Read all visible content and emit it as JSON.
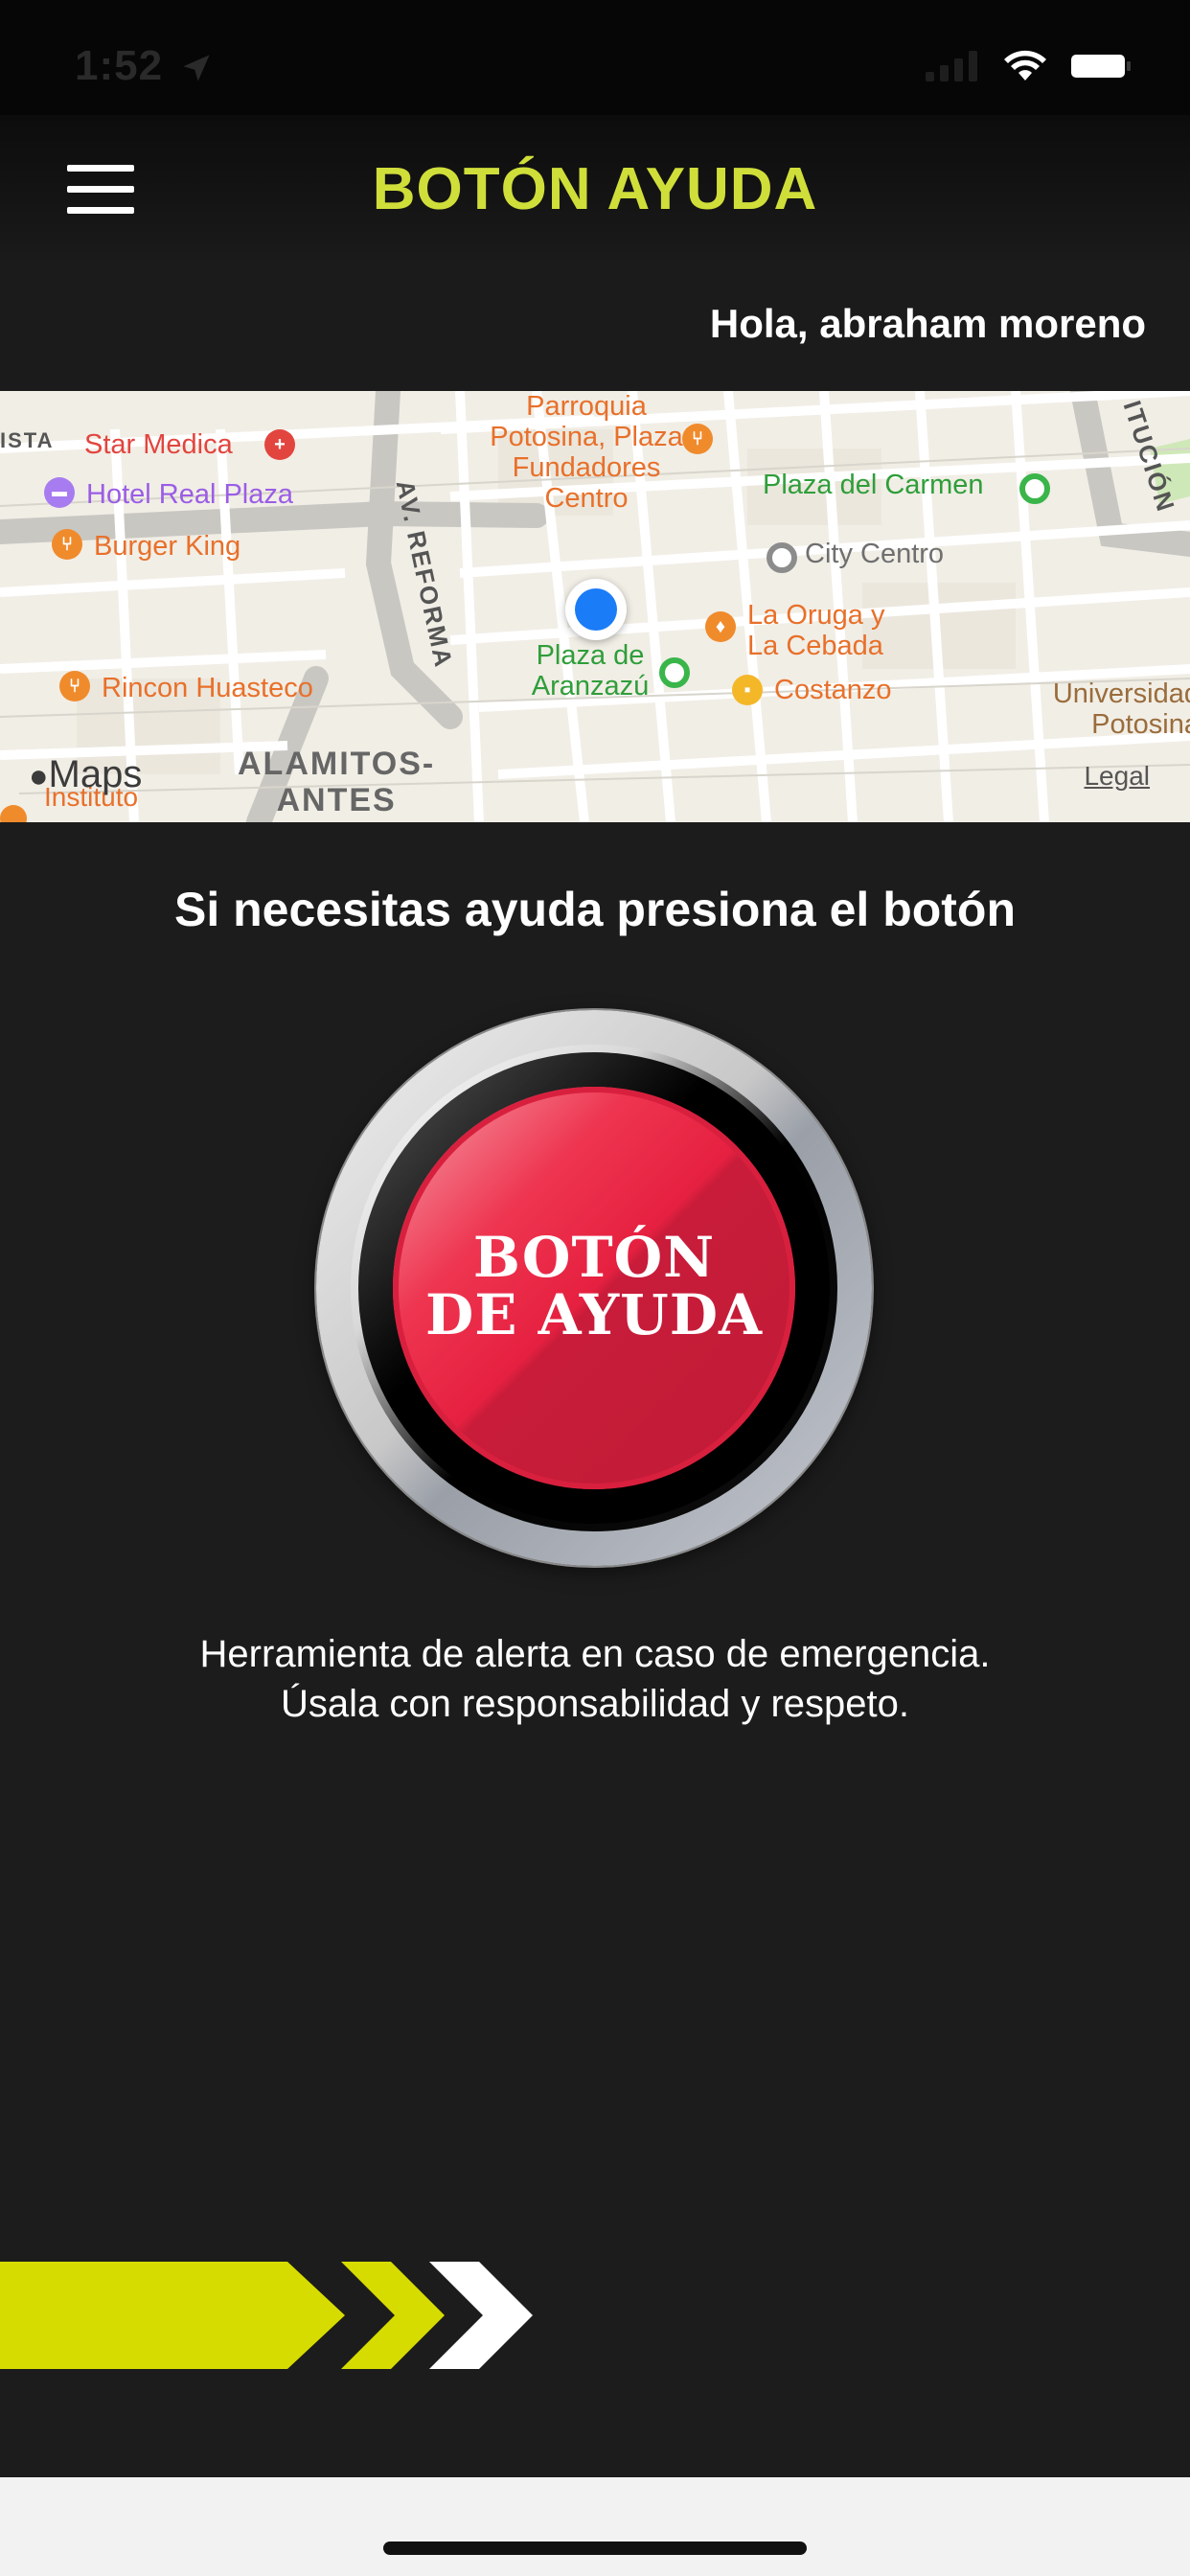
{
  "status_bar": {
    "time": "1:52"
  },
  "header": {
    "title": "BOTÓN AYUDA"
  },
  "greeting": "Hola, abraham moreno",
  "map": {
    "pois": [
      {
        "name": "Star Medica",
        "kind": "hospital"
      },
      {
        "name": "Hotel Real Plaza",
        "kind": "hotel"
      },
      {
        "name": "Burger King",
        "kind": "restaurant"
      },
      {
        "name": "Rincon Huasteco",
        "kind": "restaurant"
      },
      {
        "name": "Parroquia Potosina, Plaza Fundadores Centro",
        "kind": "restaurant"
      },
      {
        "name": "Plaza del Carmen",
        "kind": "park"
      },
      {
        "name": "City Centro",
        "kind": "place"
      },
      {
        "name": "La Oruga y La Cebada",
        "kind": "bar"
      },
      {
        "name": "Costanzo",
        "kind": "shop"
      },
      {
        "name": "Plaza de Aranzazú",
        "kind": "park"
      },
      {
        "name": "Universidad Potosina",
        "kind": "university"
      },
      {
        "name": "Instituto",
        "kind": "school"
      }
    ],
    "poi_text": {
      "star_medica": "Star Medica",
      "hotel": "Hotel Real Plaza",
      "burger": "Burger King",
      "rincon": "Rincon Huasteco",
      "parroquia_1": "Parroquia",
      "parroquia_2": "Potosina, Plaza",
      "parroquia_3": "Fundadores",
      "parroquia_4": "Centro",
      "plaza_carmen": "Plaza del Carmen",
      "city_centro": "City Centro",
      "oruga_1": "La Oruga y",
      "oruga_2": "La Cebada",
      "costanzo": "Costanzo",
      "aranzazu_1": "Plaza de",
      "aranzazu_2": "Aranzazú",
      "universidad_1": "Universidad",
      "universidad_2": "Potosina",
      "instituto": "Instituto",
      "street_reforma": "AV. REFORMA",
      "street_alamitos_1": "ALAMITOS-",
      "street_alamitos_2": "ANTES",
      "street_constitucion": "ITUCIÓN",
      "street_top_left": "ISTA"
    },
    "maps_logo": "Maps",
    "legal": "Legal"
  },
  "help": {
    "prompt": "Si necesitas ayuda presiona el botón",
    "button_line1": "BOTÓN",
    "button_line2": "DE AYUDA",
    "disclaimer_line1": "Herramienta de alerta en caso de emergencia.",
    "disclaimer_line2": "Úsala con responsabilidad y respeto."
  },
  "colors": {
    "accent": "#d0de3a",
    "background": "#1c1c1c",
    "button_red": "#e62040",
    "chevron_yellow": "#d7dc00",
    "user_location": "#1a7cf7"
  }
}
